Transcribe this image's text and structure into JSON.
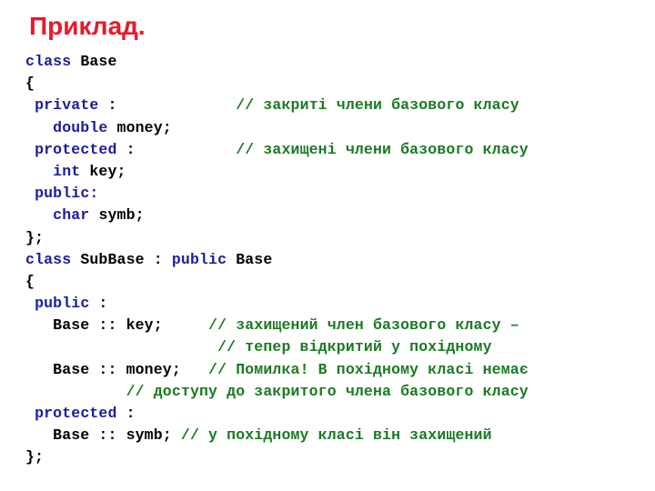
{
  "slide": {
    "title": "Приклад.",
    "title_color": "#e8192c",
    "background_color": "#ffffff"
  },
  "syntax_colors": {
    "keyword": "#1c1c9c",
    "identifier": "#000000",
    "comment": "#1a7a22",
    "punctuation": "#000000"
  },
  "code": {
    "language": "cpp",
    "lines": [
      {
        "index": 0,
        "text": "class Base",
        "tokens": [
          {
            "t": "class",
            "k": "kw"
          },
          {
            "t": " ",
            "k": "pl"
          },
          {
            "t": "Base",
            "k": "id"
          }
        ]
      },
      {
        "index": 1,
        "text": "{",
        "tokens": [
          {
            "t": "{",
            "k": "pl"
          }
        ]
      },
      {
        "index": 2,
        "text": " private :             // закриті члени базового класу",
        "tokens": [
          {
            "t": " ",
            "k": "pl"
          },
          {
            "t": "private",
            "k": "kw"
          },
          {
            "t": " :             ",
            "k": "pl"
          },
          {
            "t": "// закриті члени базового класу",
            "k": "cm"
          }
        ]
      },
      {
        "index": 3,
        "text": "   double money;",
        "tokens": [
          {
            "t": "   ",
            "k": "pl"
          },
          {
            "t": "double",
            "k": "kw"
          },
          {
            "t": " ",
            "k": "pl"
          },
          {
            "t": "money;",
            "k": "id"
          }
        ]
      },
      {
        "index": 4,
        "text": " protected :           // захищені члени базового класу",
        "tokens": [
          {
            "t": " ",
            "k": "pl"
          },
          {
            "t": "protected",
            "k": "kw"
          },
          {
            "t": " :           ",
            "k": "pl"
          },
          {
            "t": "// захищені члени базового класу",
            "k": "cm"
          }
        ]
      },
      {
        "index": 5,
        "text": "   int key;",
        "tokens": [
          {
            "t": "   ",
            "k": "pl"
          },
          {
            "t": "int",
            "k": "kw"
          },
          {
            "t": " ",
            "k": "pl"
          },
          {
            "t": "key;",
            "k": "id"
          }
        ]
      },
      {
        "index": 6,
        "text": " public:",
        "tokens": [
          {
            "t": " ",
            "k": "pl"
          },
          {
            "t": "public:",
            "k": "kw"
          }
        ]
      },
      {
        "index": 7,
        "text": "   char symb;",
        "tokens": [
          {
            "t": "   ",
            "k": "pl"
          },
          {
            "t": "char",
            "k": "kw"
          },
          {
            "t": " ",
            "k": "pl"
          },
          {
            "t": "symb;",
            "k": "id"
          }
        ]
      },
      {
        "index": 8,
        "text": "};",
        "tokens": [
          {
            "t": "};",
            "k": "pl"
          }
        ]
      },
      {
        "index": 9,
        "text": "class SubBase : public Base",
        "tokens": [
          {
            "t": "class",
            "k": "kw"
          },
          {
            "t": " SubBase : ",
            "k": "id"
          },
          {
            "t": "public",
            "k": "kw"
          },
          {
            "t": " Base",
            "k": "id"
          }
        ]
      },
      {
        "index": 10,
        "text": "{",
        "tokens": [
          {
            "t": "{",
            "k": "pl"
          }
        ]
      },
      {
        "index": 11,
        "text": " public :",
        "tokens": [
          {
            "t": " ",
            "k": "pl"
          },
          {
            "t": "public",
            "k": "kw"
          },
          {
            "t": " :",
            "k": "pl"
          }
        ]
      },
      {
        "index": 12,
        "text": "   Base :: key;     // захищений член базового класу –",
        "tokens": [
          {
            "t": "   Base :: key;     ",
            "k": "id"
          },
          {
            "t": "// захищений член базового класу –",
            "k": "cm"
          }
        ]
      },
      {
        "index": 13,
        "text": "                     // тепер відкритий у похідному",
        "tokens": [
          {
            "t": "                     ",
            "k": "pl"
          },
          {
            "t": "// тепер відкритий у похідному",
            "k": "cm"
          }
        ]
      },
      {
        "index": 14,
        "text": "   Base :: money;   // Помилка! В похідному класі немає",
        "tokens": [
          {
            "t": "   Base :: money;   ",
            "k": "id"
          },
          {
            "t": "// Помилка! В похідному класі немає",
            "k": "cm"
          }
        ]
      },
      {
        "index": 15,
        "text": "           // доступу до закритого члена базового класу",
        "tokens": [
          {
            "t": "           ",
            "k": "pl"
          },
          {
            "t": "// доступу до закритого члена базового класу",
            "k": "cm"
          }
        ]
      },
      {
        "index": 16,
        "text": " protected :",
        "tokens": [
          {
            "t": " ",
            "k": "pl"
          },
          {
            "t": "protected",
            "k": "kw"
          },
          {
            "t": " :",
            "k": "pl"
          }
        ]
      },
      {
        "index": 17,
        "text": "   Base :: symb; // у похідному класі він захищений",
        "tokens": [
          {
            "t": "   Base :: symb; ",
            "k": "id"
          },
          {
            "t": "// у похідному класі він захищений",
            "k": "cm"
          }
        ]
      },
      {
        "index": 18,
        "text": "};",
        "tokens": [
          {
            "t": "};",
            "k": "pl"
          }
        ]
      }
    ]
  }
}
